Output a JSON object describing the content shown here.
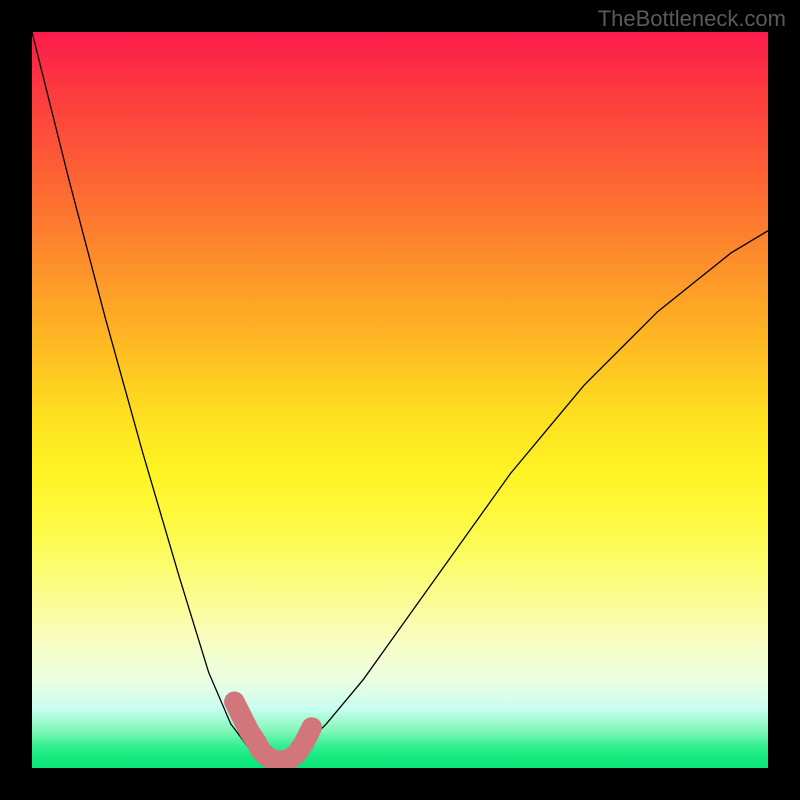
{
  "watermark": "TheBottleneck.com",
  "chart_data": {
    "type": "line",
    "title": "",
    "xlabel": "",
    "ylabel": "",
    "xlim": [
      0,
      100
    ],
    "ylim": [
      0,
      100
    ],
    "series": [
      {
        "name": "bottleneck-curve",
        "x": [
          0,
          5,
          10,
          15,
          20,
          24,
          27,
          30,
          31,
          32,
          33,
          34,
          36,
          40,
          45,
          50,
          55,
          60,
          65,
          70,
          75,
          80,
          85,
          90,
          95,
          100
        ],
        "y": [
          100,
          80,
          61,
          43,
          26,
          13,
          6,
          2,
          1,
          0.5,
          0.5,
          0.8,
          2,
          6,
          12,
          19,
          26,
          33,
          40,
          46,
          52,
          57,
          62,
          66,
          70,
          73
        ]
      }
    ],
    "accent_segment": {
      "name": "optimal-range-marker",
      "color": "#d1777b",
      "x": [
        27.5,
        28.5,
        29.5,
        30.5,
        31,
        32,
        33,
        34,
        35,
        36,
        37,
        38
      ],
      "y": [
        9,
        7,
        5,
        3.5,
        2.5,
        1.5,
        1,
        1,
        1.2,
        2,
        3.5,
        5.5
      ]
    },
    "background_gradient": {
      "top": "#fc1b4c",
      "mid": "#fedf1f",
      "bottom": "#0be677"
    }
  }
}
